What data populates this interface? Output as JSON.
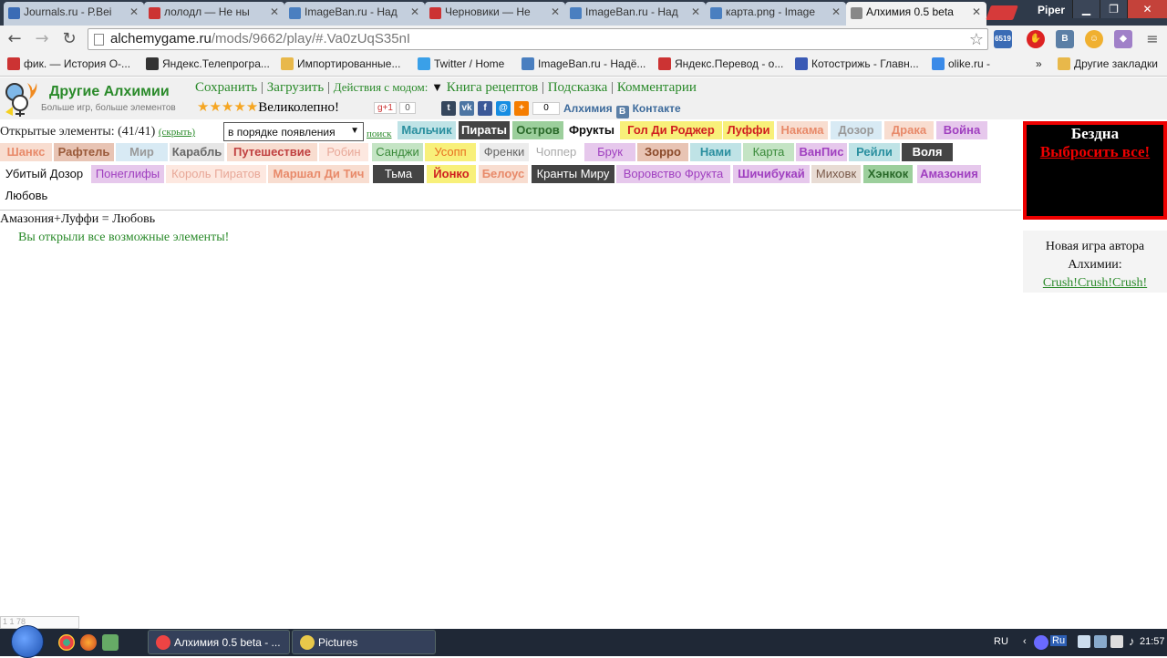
{
  "browser": {
    "tabs": [
      {
        "label": "Journals.ru - Р.Веi",
        "fav_color": "#3a6bb5"
      },
      {
        "label": "лолодл — Не ны",
        "fav_color": "#c33"
      },
      {
        "label": "ImageBan.ru - Над",
        "fav_color": "#4a7fc0"
      },
      {
        "label": "Черновики — Не",
        "fav_color": "#c33"
      },
      {
        "label": "ImageBan.ru - Над",
        "fav_color": "#4a7fc0"
      },
      {
        "label": "карта.png - Image",
        "fav_color": "#4a7fc0"
      },
      {
        "label": "Алхимия 0.5 beta",
        "fav_color": "#888"
      }
    ],
    "active_tab_index": 6,
    "profile": "Piper",
    "url_host": "alchemygame.ru",
    "url_path": "/mods/9662/play/#.Va0zUqS35nI",
    "ext_counter": "6519",
    "bookmarks": [
      {
        "label": "фик. — История О-...",
        "color": "#c33"
      },
      {
        "label": "Яндекс.Телепрогра...",
        "color": "#333"
      },
      {
        "label": "Импортированные...",
        "color": "#e8b84a"
      },
      {
        "label": "Twitter / Home",
        "color": "#3aa0e8"
      },
      {
        "label": "ImageBan.ru - Надё...",
        "color": "#4a7fc0"
      },
      {
        "label": "Яндекс.Перевод - о...",
        "color": "#c33"
      },
      {
        "label": "Котострижь - Главн...",
        "color": "#3a5ab5"
      },
      {
        "label": "olike.ru -",
        "color": "#3a8ae8"
      }
    ],
    "bookmarks_more": "»",
    "other_bookmarks": "Другие закладки"
  },
  "site": {
    "title": "Другие Алхимии",
    "subtitle": "Больше игр, больше элементов",
    "menu": {
      "save": "Сохранить",
      "load": "Загрузить",
      "mod_actions": "Действия с модом:",
      "recipes": "Книга рецептов",
      "hint": "Подсказка",
      "comments": "Комментарии"
    },
    "rating_text": "Великолепно!",
    "rating_stars": 5,
    "gplus": "g+1",
    "gplus_count": "0",
    "share_count": "0",
    "vk_label_1": "Алхимия",
    "vk_label_2": "Контакте"
  },
  "game": {
    "opened_label": "Открытые элементы: (41/41)",
    "hide_link": "(скрыть)",
    "sort_value": "в порядке появления",
    "search_link": "поиск",
    "combo_result": "Амазония+Луффи = Любовь",
    "all_found": "Вы открыли все возможные элементы!",
    "elements": [
      {
        "label": "Мальчик",
        "bg": "#bfe3e6",
        "fg": "#2a8f9f",
        "bold": true
      },
      {
        "label": "Пираты",
        "bg": "#444",
        "fg": "#fff",
        "bold": true
      },
      {
        "label": "Остров",
        "bg": "#9ccf9c",
        "fg": "#2a6a2a",
        "bold": true
      },
      {
        "label": "Фрукты",
        "bg": "#fff",
        "fg": "#111",
        "bold": true
      },
      {
        "label": "Гол Ди Роджер",
        "bg": "#f8f07a",
        "fg": "#d02020",
        "bold": true
      },
      {
        "label": "Луффи",
        "bg": "#f8f07a",
        "fg": "#d02020",
        "bold": true
      },
      {
        "label": "Накама",
        "bg": "#f8ddd0",
        "fg": "#e88a6a",
        "bold": true
      },
      {
        "label": "Дозор",
        "bg": "#d8eaf4",
        "fg": "#999",
        "bold": true
      },
      {
        "label": "Драка",
        "bg": "#f8ddd0",
        "fg": "#e88a6a",
        "bold": true
      },
      {
        "label": "Война",
        "bg": "#e6c8ec",
        "fg": "#a040c0",
        "bold": true
      },
      {
        "label": "Шанкс",
        "bg": "#f8ddd0",
        "fg": "#e88a6a",
        "bold": true
      },
      {
        "label": "Рафтель",
        "bg": "#e8c4b4",
        "fg": "#9a5a3a",
        "bold": true
      },
      {
        "label": "Мир",
        "bg": "#d8eaf4",
        "fg": "#999",
        "bold": true
      },
      {
        "label": "Карабль",
        "bg": "#e6e6e6",
        "fg": "#666",
        "bold": true
      },
      {
        "label": "Путешествие",
        "bg": "#f8ddd0",
        "fg": "#c04040",
        "bold": true
      },
      {
        "label": "Робин",
        "bg": "#fde8e0",
        "fg": "#e8a898",
        "bold": false
      },
      {
        "label": "Санджи",
        "bg": "#c4e4c4",
        "fg": "#3a8a3a",
        "bold": false
      },
      {
        "label": "Усопп",
        "bg": "#f8f07a",
        "fg": "#e87020",
        "bold": false
      },
      {
        "label": "Френки",
        "bg": "#ececec",
        "fg": "#666",
        "bold": false
      },
      {
        "label": "Чоппер",
        "bg": "#fff",
        "fg": "#aaa",
        "bold": false
      },
      {
        "label": "Брук",
        "bg": "#e6c8ec",
        "fg": "#a040c0",
        "bold": false
      },
      {
        "label": "Зорро",
        "bg": "#e8c4b4",
        "fg": "#8a4a2a",
        "bold": true
      },
      {
        "label": "Нами",
        "bg": "#bfe3e6",
        "fg": "#2a8f9f",
        "bold": true
      },
      {
        "label": "Карта",
        "bg": "#c4e4c4",
        "fg": "#3a8a3a",
        "bold": false
      },
      {
        "label": "ВанПис",
        "bg": "#e6c8ec",
        "fg": "#a040c0",
        "bold": true
      },
      {
        "label": "Рейли",
        "bg": "#bfe3e6",
        "fg": "#2a8f9f",
        "bold": true
      },
      {
        "label": "Воля",
        "bg": "#444",
        "fg": "#fff",
        "bold": true
      },
      {
        "label": "Убитый Дозор",
        "bg": "#fff",
        "fg": "#111",
        "bold": false
      },
      {
        "label": "Понеглифы",
        "bg": "#e6c8ec",
        "fg": "#a040c0",
        "bold": false
      },
      {
        "label": "Король Пиратов",
        "bg": "#fde8e0",
        "fg": "#e8a898",
        "bold": false
      },
      {
        "label": "Маршал Ди Тич",
        "bg": "#f8ddd0",
        "fg": "#e88a6a",
        "bold": true
      },
      {
        "label": "Тьма",
        "bg": "#444",
        "fg": "#fff",
        "bold": false
      },
      {
        "label": "Йонко",
        "bg": "#f8f07a",
        "fg": "#d02020",
        "bold": true
      },
      {
        "label": "Белоус",
        "bg": "#f8ddd0",
        "fg": "#e88a6a",
        "bold": true
      },
      {
        "label": "Кранты Миру",
        "bg": "#444",
        "fg": "#fff",
        "bold": false
      },
      {
        "label": "Воровство Фрукта",
        "bg": "#e6c8ec",
        "fg": "#a040c0",
        "bold": false
      },
      {
        "label": "Шичибукай",
        "bg": "#e6c8ec",
        "fg": "#a040c0",
        "bold": true
      },
      {
        "label": "Миховк",
        "bg": "#e8dcd4",
        "fg": "#7a5a4a",
        "bold": false
      },
      {
        "label": "Хэнкок",
        "bg": "#9ccf9c",
        "fg": "#2a6a2a",
        "bold": true
      },
      {
        "label": "Амазония",
        "bg": "#e6c8ec",
        "fg": "#a040c0",
        "bold": true
      },
      {
        "label": "Любовь",
        "bg": "#fff",
        "fg": "#111",
        "bold": false
      }
    ]
  },
  "abyss": {
    "title": "Бездна",
    "button": "Выбросить все!"
  },
  "promo": {
    "line1": "Новая игра автора",
    "line2": "Алхимии:",
    "link": "Crush!Crush!Crush!"
  },
  "corner_widget": "1 1 78",
  "taskbar": {
    "tasks": [
      {
        "label": "Алхимия 0.5 beta - ...",
        "icon_color": "#e44"
      },
      {
        "label": "Pictures",
        "icon_color": "#e8c84a"
      }
    ],
    "lang": "RU",
    "ime": "Ru",
    "time": "21:57"
  }
}
